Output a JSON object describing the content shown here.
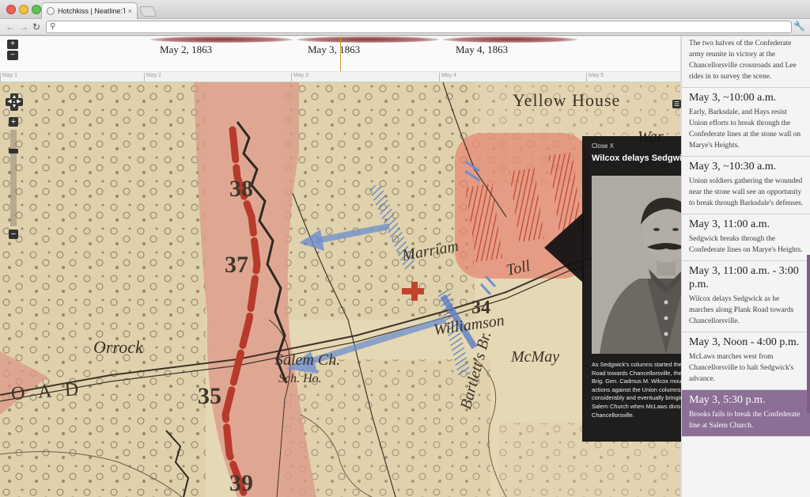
{
  "browser": {
    "tab_title": "Hotchkiss | Neatline:The Bat",
    "tab_close": "×",
    "url": ""
  },
  "timeline": {
    "dates": [
      "May 2, 1863",
      "May 3, 1863",
      "May 4, 1863"
    ],
    "ticks": [
      "May 1",
      "May 2",
      "May 3",
      "May 4",
      "May 5"
    ],
    "zoom_in": "+",
    "zoom_out": "−"
  },
  "map": {
    "labels": {
      "yellow_house": "Yellow House",
      "orrock": "Orrock",
      "road": "O A D",
      "salem_ch": "Salem Ch.",
      "sch_ho": "Sch. Ho.",
      "williamson": "Williamson",
      "mcmay": "McMay",
      "marriam": "Marriam",
      "bartletts_br": "Bartlett's Br.",
      "war": "War",
      "tollgate": "Toll"
    },
    "numbers": [
      "38",
      "37",
      "35",
      "39",
      "34"
    ],
    "zoom_in": "+",
    "zoom_out": "−",
    "colors": {
      "confederate": "#c0442e",
      "union": "#5a7ec5",
      "paper": "#e4d7b5"
    }
  },
  "popup": {
    "close": "Close X",
    "title": "Wilcox delays Sedgwick's advance",
    "body": "As Sedgwick's columns started the march along Plank Road towards Chancellorsville, the Alabama brigade of Brig. Gen. Cadmus M. Wilcox mounted a series of small actions against the Union columns, slowing them considerably and eventually bringing them to a halt near Salem Church when McLaws division arrived from Chancellorsville."
  },
  "sidebar": {
    "items": [
      {
        "time": "",
        "desc": "The two halves of the Confederate army reunite in victory at the Chancellorsville crossroads and Lee rides in to survey the scene."
      },
      {
        "time": "May 3, ~10:00 a.m.",
        "desc": "Early, Barksdale, and Hays resist Union efforts to break through the Confederate lines at the stone wall on Marye's Heights."
      },
      {
        "time": "May 3, ~10:30 a.m.",
        "desc": "Union soldiers gathering the wounded near the stone wall see an opportunity to break through Barksdale's defenses."
      },
      {
        "time": "May 3, 11:00 a.m.",
        "desc": "Sedgwick breaks through the Confederate lines on Marye's Heights."
      },
      {
        "time": "May 3, 11:00 a.m. - 3:00 p.m.",
        "desc": "Wilcox delays Sedgwick as he marches along Plank Road towards Chancellorsville."
      },
      {
        "time": "May 3, Noon - 4:00 p.m.",
        "desc": "McLaws marches west from Chancellorsville to halt Sedgwick's advance."
      },
      {
        "time": "May 3, 5:30 p.m.",
        "desc": "Brooks fails to break the Confederate line at Salem Church."
      }
    ]
  }
}
